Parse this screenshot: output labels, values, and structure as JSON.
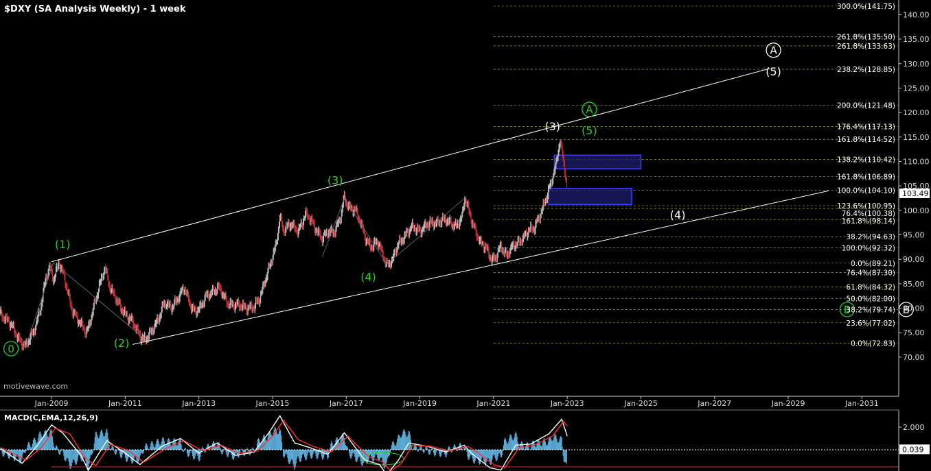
{
  "header": {
    "title": "$DXY (SA Analysis Weekly) - 1 week",
    "watermark": "motivewave.com"
  },
  "chart_data": [
    {
      "type": "line",
      "title": "$DXY (SA Analysis Weekly) - 1 week",
      "price_axis": {
        "ylim": [
          62,
          143
        ],
        "ticks": [
          "70.00",
          "75.00",
          "80.00",
          "85.00",
          "90.00",
          "95.00",
          "100.00",
          "105.00",
          "110.00",
          "115.00",
          "120.00",
          "125.00",
          "130.00",
          "135.00",
          "140.00"
        ],
        "tick_values": [
          70,
          75,
          80,
          85,
          90,
          95,
          100,
          105,
          110,
          115,
          120,
          125,
          130,
          135,
          140
        ],
        "current_price": "103.49"
      },
      "time_axis": {
        "xlim": [
          2007.6,
          2032.0
        ],
        "ticks": [
          "Jan-2009",
          "Jan-2011",
          "Jan-2013",
          "Jan-2015",
          "Jan-2017",
          "Jan-2019",
          "Jan-2021",
          "Jan-2023",
          "Jan-2025",
          "Jan-2027",
          "Jan-2029",
          "Jan-2031"
        ],
        "tick_values": [
          2009,
          2011,
          2013,
          2015,
          2017,
          2019,
          2021,
          2023,
          2025,
          2027,
          2029,
          2031
        ]
      },
      "price_path": [
        [
          2007.62,
          79
        ],
        [
          2007.85,
          77
        ],
        [
          2008.1,
          74
        ],
        [
          2008.3,
          72.1
        ],
        [
          2008.5,
          75
        ],
        [
          2008.7,
          80
        ],
        [
          2008.85,
          86
        ],
        [
          2008.95,
          88.5
        ],
        [
          2009.05,
          86
        ],
        [
          2009.2,
          89.3
        ],
        [
          2009.35,
          86
        ],
        [
          2009.55,
          80
        ],
        [
          2009.75,
          77
        ],
        [
          2009.95,
          75
        ],
        [
          2010.1,
          79
        ],
        [
          2010.25,
          83
        ],
        [
          2010.45,
          88.5
        ],
        [
          2010.6,
          84
        ],
        [
          2010.8,
          81
        ],
        [
          2011.0,
          79
        ],
        [
          2011.2,
          77
        ],
        [
          2011.4,
          74.5
        ],
        [
          2011.55,
          73.6
        ],
        [
          2011.7,
          74.8
        ],
        [
          2011.9,
          78
        ],
        [
          2012.05,
          81
        ],
        [
          2012.25,
          80
        ],
        [
          2012.45,
          82.5
        ],
        [
          2012.6,
          84
        ],
        [
          2012.75,
          81
        ],
        [
          2012.9,
          79.5
        ],
        [
          2013.05,
          80
        ],
        [
          2013.2,
          82.5
        ],
        [
          2013.35,
          83.5
        ],
        [
          2013.55,
          84
        ],
        [
          2013.75,
          81.5
        ],
        [
          2013.95,
          80.5
        ],
        [
          2014.15,
          80.5
        ],
        [
          2014.35,
          80.2
        ],
        [
          2014.5,
          80
        ],
        [
          2014.65,
          82
        ],
        [
          2014.8,
          86
        ],
        [
          2014.95,
          89
        ],
        [
          2015.1,
          93
        ],
        [
          2015.2,
          99
        ],
        [
          2015.3,
          96
        ],
        [
          2015.5,
          97
        ],
        [
          2015.7,
          96
        ],
        [
          2015.9,
          99
        ],
        [
          2016.05,
          98
        ],
        [
          2016.2,
          96
        ],
        [
          2016.35,
          94
        ],
        [
          2016.5,
          95.5
        ],
        [
          2016.7,
          96
        ],
        [
          2016.85,
          98.5
        ],
        [
          2016.95,
          102.5
        ],
        [
          2017.05,
          101
        ],
        [
          2017.25,
          100
        ],
        [
          2017.4,
          97
        ],
        [
          2017.55,
          94
        ],
        [
          2017.7,
          92.5
        ],
        [
          2017.85,
          93.5
        ],
        [
          2018.0,
          91
        ],
        [
          2018.1,
          89
        ],
        [
          2018.25,
          89.5
        ],
        [
          2018.4,
          93
        ],
        [
          2018.6,
          95
        ],
        [
          2018.8,
          96.5
        ],
        [
          2019.0,
          96
        ],
        [
          2019.2,
          97
        ],
        [
          2019.4,
          97.5
        ],
        [
          2019.6,
          98
        ],
        [
          2019.8,
          97.5
        ],
        [
          2020.0,
          97
        ],
        [
          2020.15,
          98.5
        ],
        [
          2020.22,
          102.5
        ],
        [
          2020.35,
          99.5
        ],
        [
          2020.5,
          96
        ],
        [
          2020.65,
          93
        ],
        [
          2020.8,
          92.5
        ],
        [
          2020.95,
          90
        ],
        [
          2021.05,
          90.2
        ],
        [
          2021.2,
          92.5
        ],
        [
          2021.35,
          91
        ],
        [
          2021.5,
          92.5
        ],
        [
          2021.65,
          93
        ],
        [
          2021.8,
          94.5
        ],
        [
          2021.95,
          96
        ],
        [
          2022.1,
          96
        ],
        [
          2022.25,
          99
        ],
        [
          2022.4,
          102
        ],
        [
          2022.55,
          105
        ],
        [
          2022.7,
          109.5
        ],
        [
          2022.8,
          114.7
        ],
        [
          2022.9,
          110
        ],
        [
          2023.0,
          104
        ]
      ],
      "fib_levels": [
        {
          "label": "300.0%(141.75)",
          "value": 141.75
        },
        {
          "label": "261.8%(135.50)",
          "value": 135.5
        },
        {
          "label": "261.8%(133.63)",
          "value": 133.63
        },
        {
          "label": "238.2%(128.85)",
          "value": 128.85
        },
        {
          "label": "200.0%(121.48)",
          "value": 121.48
        },
        {
          "label": "176.4%(117.13)",
          "value": 117.13
        },
        {
          "label": "161.8%(114.52)",
          "value": 114.52
        },
        {
          "label": "138.2%(110.42)",
          "value": 110.42
        },
        {
          "label": "161.8%(106.89)",
          "value": 106.89
        },
        {
          "label": "100.0%(104.10)",
          "value": 104.1
        },
        {
          "label": "123.6%(100.95)",
          "value": 100.95
        },
        {
          "label": "76.4%(100.38)",
          "value": 100.38
        },
        {
          "label": "161.8%(98.14)",
          "value": 98.14
        },
        {
          "label": "38.2%(94.63)",
          "value": 94.63
        },
        {
          "label": "100.0%(92.32)",
          "value": 92.32
        },
        {
          "label": "0.0%(89.21)",
          "value": 89.21
        },
        {
          "label": "76.4%(87.30)",
          "value": 87.3
        },
        {
          "label": "61.8%(84.32)",
          "value": 84.32
        },
        {
          "label": "50.0%(82.00)",
          "value": 82.0
        },
        {
          "label": "38.2%(79.74)",
          "value": 79.74
        },
        {
          "label": "23.6%(77.02)",
          "value": 77.02
        },
        {
          "label": "0.0%(72.83)",
          "value": 72.83
        }
      ],
      "channel": [
        {
          "from": [
            2009.0,
            89.5
          ],
          "to": [
            2028.5,
            129.0
          ]
        },
        {
          "from": [
            2011.2,
            72.6
          ],
          "to": [
            2030.1,
            104.0
          ]
        }
      ],
      "target_boxes": [
        {
          "x": [
            2022.65,
            2025.0
          ],
          "y": [
            108.5,
            111.3
          ]
        },
        {
          "x": [
            2022.5,
            2024.75
          ],
          "y": [
            101.2,
            104.5
          ]
        }
      ],
      "wave_labels": [
        {
          "text": "0",
          "x": 2007.9,
          "y": 70.9,
          "color": "#22d322",
          "circled": true
        },
        {
          "text": "(1)",
          "x": 2009.3,
          "y": 92.3,
          "color": "#22d322",
          "circled": false
        },
        {
          "text": "(2)",
          "x": 2010.9,
          "y": 72.1,
          "color": "#22d322",
          "circled": false
        },
        {
          "text": "(3)",
          "x": 2016.7,
          "y": 105.4,
          "color": "#22d322",
          "circled": false
        },
        {
          "text": "(4)",
          "x": 2017.6,
          "y": 85.6,
          "color": "#22d322",
          "circled": false
        },
        {
          "text": "(3)",
          "x": 2022.6,
          "y": 116.4,
          "color": "#ffffff",
          "circled": false
        },
        {
          "text": "(5)",
          "x": 2023.6,
          "y": 115.5,
          "color": "#22d322",
          "circled": false
        },
        {
          "text": "A",
          "x": 2023.6,
          "y": 119.8,
          "color": "#22d322",
          "circled": true
        },
        {
          "text": "A",
          "x": 2028.6,
          "y": 131.9,
          "color": "#ffffff",
          "circled": true
        },
        {
          "text": "(5)",
          "x": 2028.6,
          "y": 127.6,
          "color": "#ffffff",
          "circled": false
        },
        {
          "text": "(4)",
          "x": 2026.0,
          "y": 98.3,
          "color": "#ffffff",
          "circled": false
        },
        {
          "text": "B",
          "x": 2030.6,
          "y": 78.9,
          "color": "#22d322",
          "circled": true
        },
        {
          "text": "B",
          "x": 2032.2,
          "y": 78.9,
          "color": "#ffffff",
          "circled": true
        }
      ]
    },
    {
      "type": "line",
      "title": "MACD(C,EMA,12,26,9)",
      "ticks": [
        "2.000"
      ],
      "tick_values": [
        2.0
      ],
      "current_value": "0.039",
      "series": [
        {
          "color": "#ffffff",
          "points": [
            [
              2007.62,
              0.1
            ],
            [
              2008.2,
              -1.2
            ],
            [
              2008.6,
              0.3
            ],
            [
              2009.0,
              2.2
            ],
            [
              2009.3,
              1.5
            ],
            [
              2009.8,
              -0.5
            ],
            [
              2010.0,
              -1.8
            ],
            [
              2010.5,
              0.8
            ],
            [
              2011.0,
              -0.3
            ],
            [
              2011.4,
              -1.3
            ],
            [
              2012.0,
              0.3
            ],
            [
              2012.5,
              1.0
            ],
            [
              2013.0,
              -0.3
            ],
            [
              2013.5,
              0.6
            ],
            [
              2014.0,
              -0.5
            ],
            [
              2014.5,
              -0.2
            ],
            [
              2014.9,
              1.5
            ],
            [
              2015.2,
              3.0
            ],
            [
              2015.6,
              0.6
            ],
            [
              2016.0,
              0.2
            ],
            [
              2016.5,
              -0.4
            ],
            [
              2016.95,
              1.5
            ],
            [
              2017.5,
              -0.9
            ],
            [
              2017.9,
              -1.3
            ],
            [
              2018.1,
              -2.2
            ],
            [
              2018.4,
              -1.0
            ],
            [
              2018.7,
              0.6
            ],
            [
              2019.2,
              0.3
            ],
            [
              2019.7,
              -0.2
            ],
            [
              2020.2,
              0.4
            ],
            [
              2020.4,
              -0.3
            ],
            [
              2020.9,
              -1.6
            ],
            [
              2021.2,
              -1.8
            ],
            [
              2021.6,
              0.4
            ],
            [
              2022.0,
              0.5
            ],
            [
              2022.5,
              1.4
            ],
            [
              2022.85,
              2.7
            ],
            [
              2023.0,
              1.2
            ]
          ]
        },
        {
          "color": "#ff3030",
          "points": [
            [
              2007.62,
              0.2
            ],
            [
              2008.3,
              -0.9
            ],
            [
              2008.7,
              0.1
            ],
            [
              2009.1,
              1.9
            ],
            [
              2009.5,
              1.4
            ],
            [
              2009.9,
              -0.7
            ],
            [
              2010.2,
              -1.4
            ],
            [
              2010.6,
              0.5
            ],
            [
              2011.1,
              -0.1
            ],
            [
              2011.5,
              -1.1
            ],
            [
              2012.1,
              0.1
            ],
            [
              2012.6,
              0.8
            ],
            [
              2013.1,
              -0.1
            ],
            [
              2013.6,
              0.4
            ],
            [
              2014.1,
              -0.3
            ],
            [
              2014.6,
              -0.1
            ],
            [
              2015.0,
              1.2
            ],
            [
              2015.3,
              2.6
            ],
            [
              2015.7,
              0.9
            ],
            [
              2016.1,
              0.3
            ],
            [
              2016.6,
              -0.2
            ],
            [
              2017.05,
              1.2
            ],
            [
              2017.6,
              -0.6
            ],
            [
              2018.0,
              -1.1
            ],
            [
              2018.2,
              -1.9
            ],
            [
              2018.5,
              -1.2
            ],
            [
              2018.8,
              0.4
            ],
            [
              2019.3,
              0.3
            ],
            [
              2019.8,
              -0.1
            ],
            [
              2020.3,
              0.3
            ],
            [
              2020.5,
              -0.1
            ],
            [
              2021.0,
              -1.3
            ],
            [
              2021.3,
              -1.6
            ],
            [
              2021.7,
              0.2
            ],
            [
              2022.1,
              0.4
            ],
            [
              2022.6,
              1.2
            ],
            [
              2022.9,
              2.5
            ],
            [
              2023.0,
              2.1
            ]
          ]
        }
      ]
    }
  ],
  "colors": {
    "background": "#000000",
    "bullish_candle": "#bfbfbf",
    "bearish_candle": "#c8323a",
    "fib_line": "#b4b400",
    "wave_green": "#22d322",
    "box_fill": "#1e1e6e",
    "box_border": "#3c3cff"
  }
}
